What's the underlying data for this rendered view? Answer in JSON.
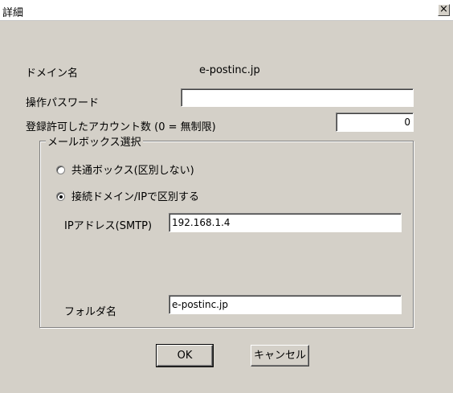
{
  "window": {
    "title": "詳細",
    "close_symbol": "×"
  },
  "fields": {
    "domain_label": "ドメイン名",
    "domain_value": "e-postinc.jp",
    "password_label": "操作パスワード",
    "password_value": "",
    "accounts_label": "登録許可したアカウント数 (0 = 無制限)",
    "accounts_value": "0"
  },
  "mailbox": {
    "group_label": "メールボックス選択",
    "options": [
      {
        "label": "共通ボックス(区別しない)",
        "checked": false
      },
      {
        "label": "接続ドメイン/IPで区別する",
        "checked": true
      }
    ],
    "ip_label": "IPアドレス(SMTP)",
    "ip_value": "192.168.1.4",
    "folder_label": "フォルダ名",
    "folder_value": "e-postinc.jp"
  },
  "buttons": {
    "ok": "OK",
    "cancel": "キャンセル"
  }
}
